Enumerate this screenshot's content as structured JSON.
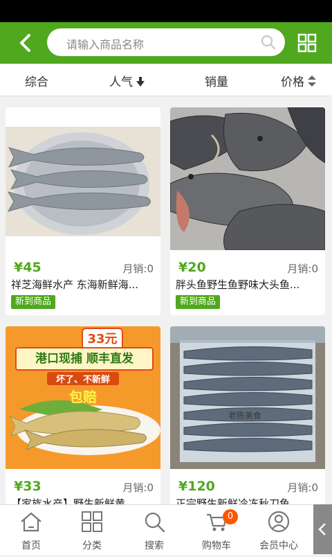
{
  "search": {
    "placeholder": "请输入商品名称"
  },
  "sort": {
    "items": [
      "综合",
      "人气",
      "销量",
      "价格"
    ]
  },
  "products": [
    {
      "price": "¥45",
      "sales": "月销:0",
      "title": "祥芝海鲜水产 东海新鲜海...",
      "badge": "新到商品"
    },
    {
      "price": "¥20",
      "sales": "月销:0",
      "title": "胖头鱼野生鱼野味大头鱼...",
      "badge": "新到商品"
    },
    {
      "price": "¥33",
      "sales": "月销:0",
      "title": "【家族水产】野生新鲜黄...",
      "promo": {
        "price_tag": "33元",
        "headline": "港口现捕 顺丰直发",
        "sub": "坏了、不新鲜",
        "guarantee": "包赔"
      }
    },
    {
      "price": "¥120",
      "sales": "月销:0",
      "title": "正宗野生新鲜冷冻秋刀鱼...",
      "watermark": "老陈美食"
    }
  ],
  "tabbar": {
    "items": [
      "首页",
      "分类",
      "搜索",
      "购物车",
      "会员中心"
    ],
    "cart_count": "0"
  },
  "colors": {
    "accent": "#4fa81e",
    "badge": "#ff5500"
  }
}
